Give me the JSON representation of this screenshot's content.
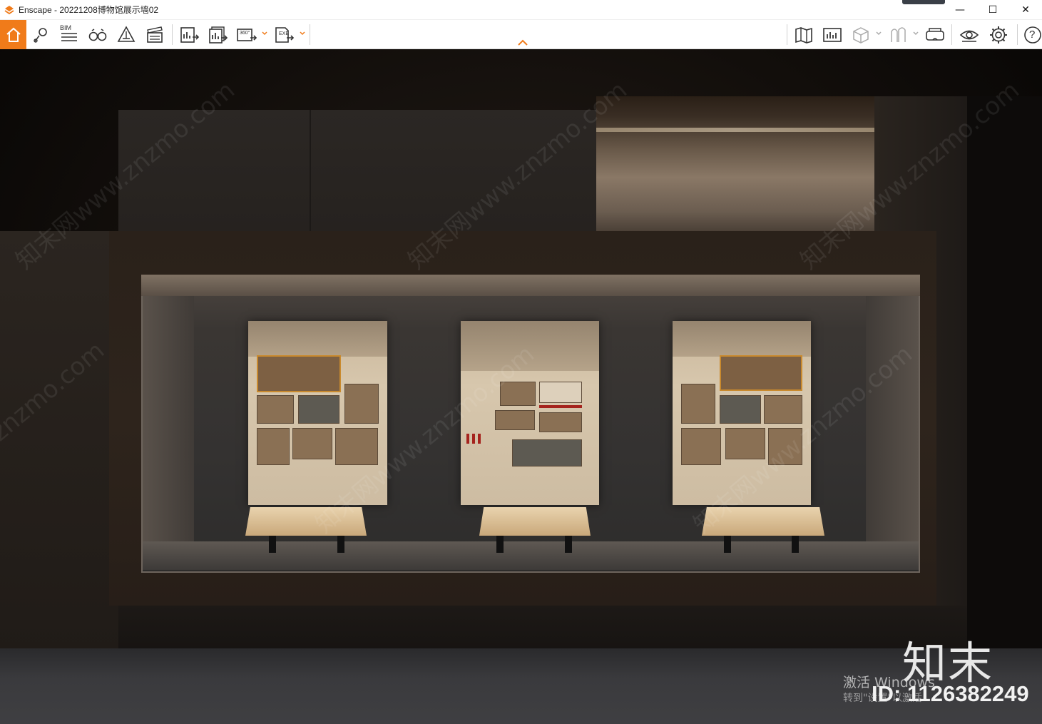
{
  "window": {
    "app_name": "Enscape",
    "title": "Enscape - 20221208博物馆展示墙02",
    "minimize_label": "—",
    "maximize_label": "☐",
    "close_label": "✕"
  },
  "toolbar": {
    "bim_label": "BIM",
    "pano_label": "360°",
    "exe_label": "EXE",
    "help_label": "?",
    "icons_left": [
      "home-icon",
      "map-pin-icon",
      "bim-icon",
      "binoculars-icon",
      "section-icon",
      "clapper-icon",
      "render-image-icon",
      "batch-render-icon",
      "panorama-icon",
      "export-exe-icon"
    ],
    "icons_right": [
      "map-icon",
      "minimap-icon",
      "cube-icon",
      "assets-icon",
      "vr-headset-icon",
      "visual-settings-icon",
      "settings-icon",
      "help-icon"
    ]
  },
  "colors": {
    "accent": "#f07b1a",
    "toolbar_bg": "#ffffff",
    "icon": "#333333"
  },
  "watermarks": {
    "site": "知末网www.znzmo.com",
    "site_short": "znzmo.com"
  },
  "overlay": {
    "brand": "知末",
    "activate_line1": "激活 Windows",
    "activate_line2": "转到\"设置\"以激活",
    "id_label": "ID: 1126382249"
  }
}
